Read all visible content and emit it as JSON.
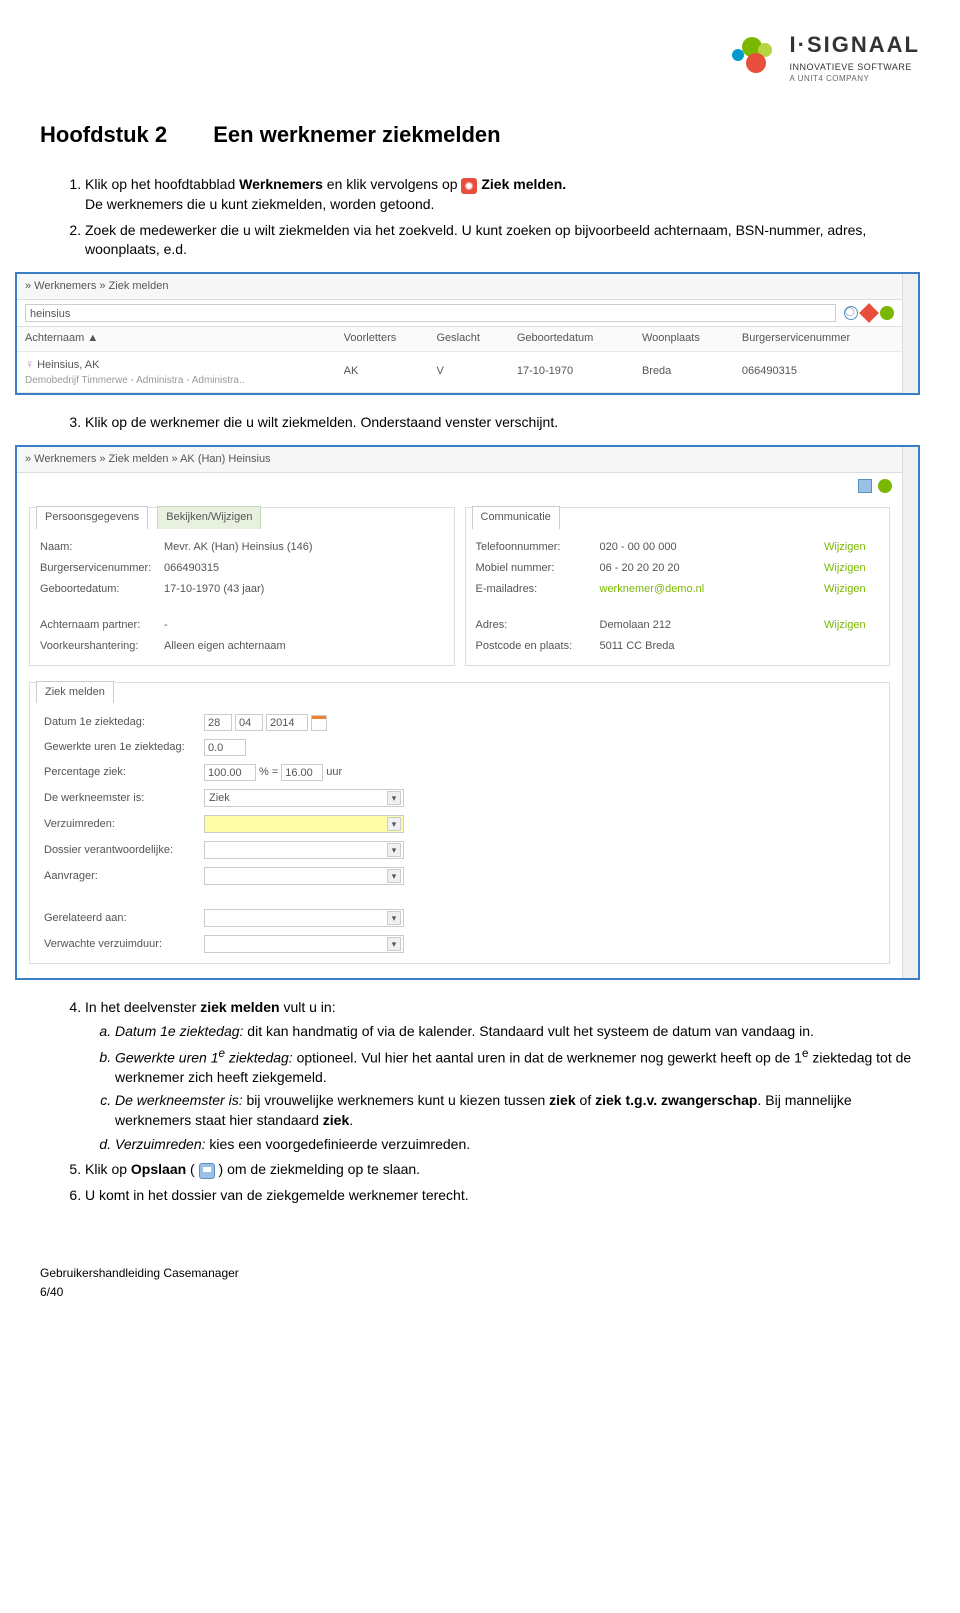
{
  "logo": {
    "main": "I·SIGNAAL",
    "sub": "INNOVATIEVE SOFTWARE",
    "sub2": "A UNIT4 COMPANY"
  },
  "heading": {
    "chapter": "Hoofdstuk 2",
    "title": "Een werknemer ziekmelden"
  },
  "steps": {
    "s1a": "Klik op het hoofdtabblad ",
    "s1b": "Werknemers",
    "s1c": " en klik vervolgens op ",
    "s1d": "Ziek melden.",
    "s1e": "De werknemers die u kunt ziekmelden, worden getoond.",
    "s2": "Zoek de medewerker die u wilt ziekmelden via het zoekveld. U kunt zoeken op bijvoorbeeld achternaam, BSN-nummer,  adres, woonplaats, e.d.",
    "s3": "Klik op de werknemer die u wilt ziekmelden. Onderstaand venster verschijnt.",
    "s4": "In het deelvenster ",
    "s4b": "ziek melden",
    "s4c": " vult u in:",
    "s4a_i": "Datum 1e ziektedag:",
    "s4a_t": " dit kan handmatig of via de kalender. Standaard vult het systeem de datum van vandaag in.",
    "s4b_i": "Gewerkte uren 1",
    "s4b_e": "e",
    "s4b_i2": " ziektedag:",
    "s4b_t": " optioneel. Vul hier het aantal uren in dat de werknemer nog gewerkt heeft op de 1",
    "s4b_t2": " ziektedag tot de werknemer zich heeft ziekgemeld.",
    "s4c_i": "De werkneemster is:",
    "s4c_t": " bij vrouwelijke werknemers kunt u kiezen tussen ",
    "s4c_z": "ziek",
    "s4c_o": " of ",
    "s4c_tgv": "t.g.v. zwangerschap",
    ". ": "",
    "s4c_t2": ". Bij mannelijke werknemers staat hier standaard ",
    "s4c_t3": ".",
    "s4d_i": "Verzuimreden:",
    "s4d_t": " kies een voorgedefinieerde verzuimreden.",
    "s5a": "Klik op ",
    "s5b": "Opslaan",
    "s5c": " ( ",
    "s5d": " ) om de ziekmelding op te slaan.",
    "s6": "U komt in het dossier van de ziekgemelde werknemer terecht."
  },
  "ss1": {
    "breadcrumb": "» Werknemers  » Ziek melden",
    "search": "heinsius",
    "headers": [
      "Achternaam ▲",
      "Voorletters",
      "Geslacht",
      "Geboortedatum",
      "Woonplaats",
      "Burgerservicenummer"
    ],
    "row": {
      "name": "Heinsius, AK",
      "sub": "Demobedrijf Timmerwe - Administra - Administra..",
      "v": "AK",
      "g": "V",
      "d": "17-10-1970",
      "w": "Breda",
      "b": "066490315"
    }
  },
  "ss2": {
    "breadcrumb": "» Werknemers » Ziek melden » AK (Han) Heinsius",
    "tabs": {
      "p1": "Persoonsgegevens",
      "p1b": "Bekijken/Wijzigen",
      "p2": "Communicatie",
      "p3": "Ziek melden"
    },
    "left": {
      "l1": "Naam:",
      "v1": "Mevr. AK (Han) Heinsius (146)",
      "l2": "Burgerservicenummer:",
      "v2": "066490315",
      "l3": "Geboortedatum:",
      "v3": "17-10-1970 (43 jaar)",
      "l4": "Achternaam partner:",
      "v4": "-",
      "l5": "Voorkeurshantering:",
      "v5": "Alleen eigen achternaam"
    },
    "right": {
      "l1": "Telefoonnummer:",
      "v1": "020 - 00 00 000",
      "a1": "Wijzigen",
      "l2": "Mobiel nummer:",
      "v2": "06 - 20 20 20 20",
      "a2": "Wijzigen",
      "l3": "E-mailadres:",
      "v3": "werknemer@demo.nl",
      "a3": "Wijzigen",
      "l4": "Adres:",
      "v4": "Demolaan 212",
      "a4": "Wijzigen",
      "l5": "Postcode en plaats:",
      "v5": "5011 CC Breda"
    },
    "form": {
      "l1": "Datum 1e ziektedag:",
      "d1": "28",
      "d2": "04",
      "d3": "2014",
      "l2": "Gewerkte uren 1e ziektedag:",
      "v2": "0.0",
      "l3": "Percentage ziek:",
      "v3a": "100.00",
      "v3b": "% =",
      "v3c": "16.00",
      "v3d": "uur",
      "l4": "De werkneemster is:",
      "v4": "Ziek",
      "l5": "Verzuimreden:",
      "l6": "Dossier verantwoordelijke:",
      "l7": "Aanvrager:",
      "l8": "Gerelateerd aan:",
      "l9": "Verwachte verzuimduur:"
    }
  },
  "footer": {
    "t": "Gebruikershandleiding Casemanager",
    "p": "6/40"
  }
}
